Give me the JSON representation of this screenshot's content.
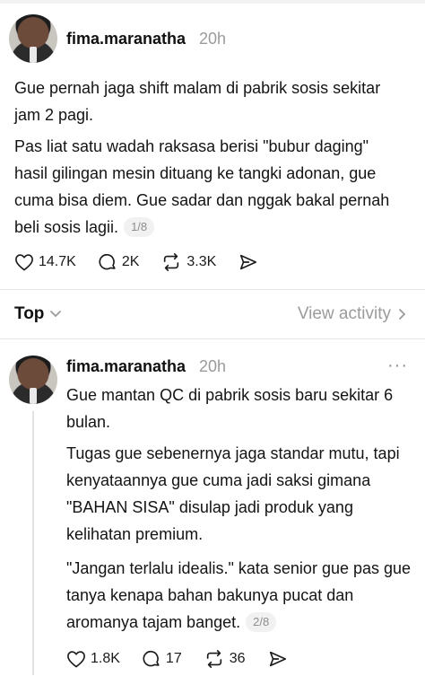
{
  "post1": {
    "username": "fima.maranatha",
    "time": "20h",
    "para1": "Gue pernah jaga shift malam di pabrik sosis sekitar jam 2 pagi.",
    "para2": "Pas liat satu wadah raksasa berisi \"bubur daging\" hasil gilingan mesin dituang ke tangki adonan, gue cuma bisa diem. Gue sadar dan nggak bakal pernah beli sosis lagii.",
    "pager": "1/8",
    "likes": "14.7K",
    "replies": "2K",
    "reposts": "3.3K"
  },
  "sort": {
    "label": "Top",
    "view_activity": "View activity"
  },
  "post2": {
    "username": "fima.maranatha",
    "time": "20h",
    "more": "···",
    "para1": "Gue mantan QC di pabrik sosis baru sekitar 6 bulan.",
    "para2": "Tugas gue sebenernya jaga standar mutu, tapi kenyataannya gue cuma jadi saksi gimana \"BAHAN SISA\" disulap jadi produk yang kelihatan premium.",
    "para3": "\"Jangan terlalu idealis.\" kata senior gue pas gue tanya kenapa bahan bakunya pucat dan aromanya tajam banget.",
    "pager": "2/8",
    "likes": "1.8K",
    "replies": "17",
    "reposts": "36"
  },
  "icons": [
    "heart-icon",
    "comment-icon",
    "repost-icon",
    "share-icon",
    "chevron-down-icon",
    "chevron-right-icon",
    "more-icon"
  ]
}
